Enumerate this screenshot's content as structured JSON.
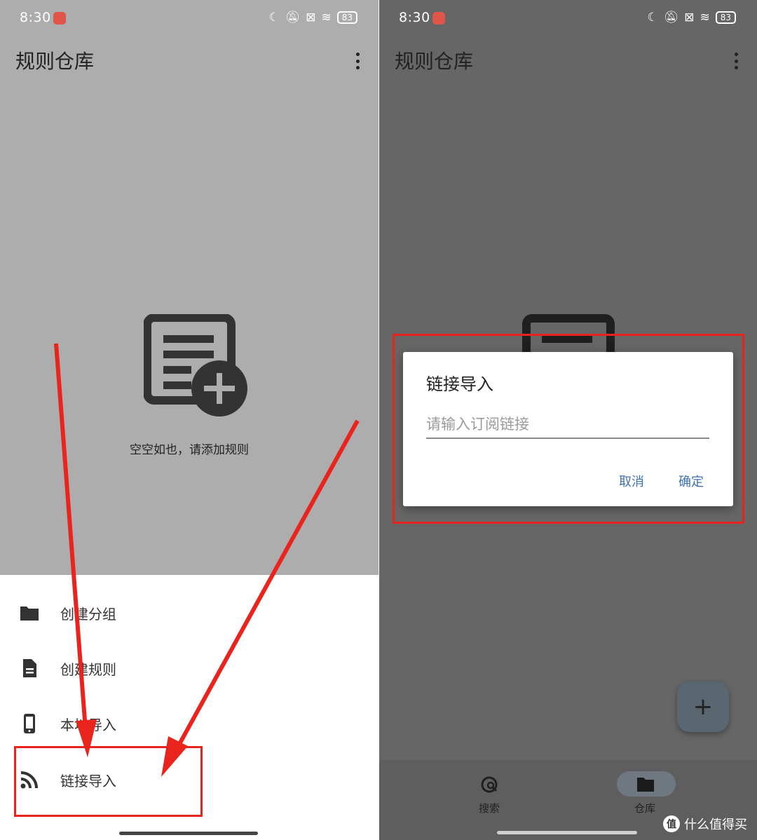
{
  "status_bar": {
    "time": "8:30",
    "battery": "83"
  },
  "left_screen": {
    "app_title": "规则仓库",
    "empty_state_text": "空空如也，请添加规则",
    "menu_items": [
      {
        "label": "创建分组",
        "icon": "folder-icon"
      },
      {
        "label": "创建规则",
        "icon": "document-icon"
      },
      {
        "label": "本地导入",
        "icon": "phone-icon"
      },
      {
        "label": "链接导入",
        "icon": "rss-icon"
      }
    ]
  },
  "right_screen": {
    "app_title": "规则仓库",
    "dialog": {
      "title": "链接导入",
      "input_placeholder": "请输入订阅链接",
      "input_value": "",
      "cancel_label": "取消",
      "confirm_label": "确定"
    },
    "fab_label": "+",
    "nav_items": [
      {
        "label": "搜索",
        "icon": "search-globe-icon",
        "selected": false
      },
      {
        "label": "仓库",
        "icon": "folder-icon",
        "selected": true
      }
    ]
  },
  "watermark": {
    "logo": "值",
    "text": "什么值得买"
  },
  "colors": {
    "annotation_red": "#e8241c",
    "dialog_button_blue": "#3f6fb5",
    "left_scrim": "#adadad",
    "right_scrim": "#666666"
  }
}
